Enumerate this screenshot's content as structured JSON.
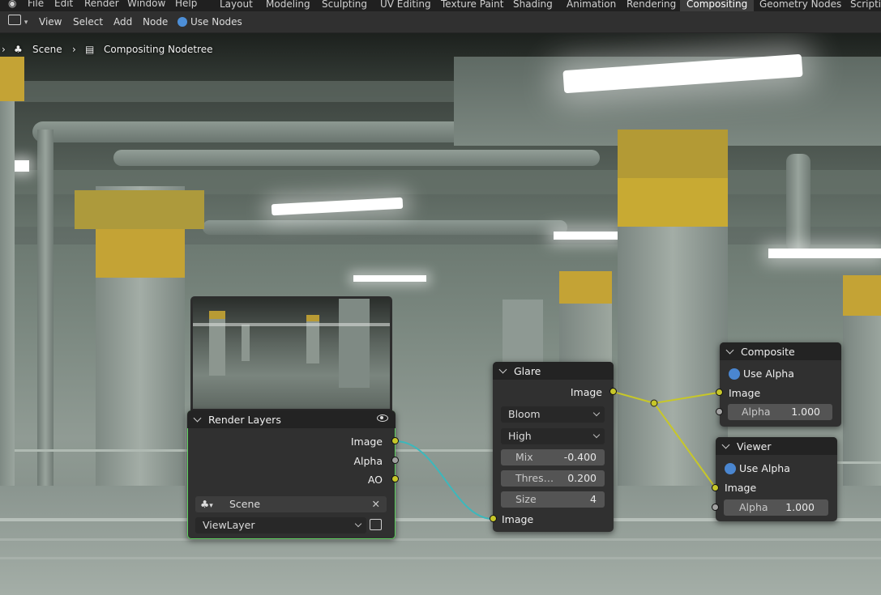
{
  "topbar": {
    "menus": [
      "File",
      "Edit",
      "Render",
      "Window",
      "Help"
    ],
    "workspaces": [
      "Layout",
      "Modeling",
      "Sculpting",
      "UV Editing",
      "Texture Paint",
      "Shading",
      "Animation",
      "Rendering",
      "Compositing",
      "Geometry Nodes",
      "Scripting"
    ],
    "active_workspace": "Compositing"
  },
  "header": {
    "editor_icon": "node-editor-icon",
    "menus": [
      "View",
      "Select",
      "Add",
      "Node"
    ],
    "use_nodes_label": "Use Nodes",
    "use_nodes_checked": true
  },
  "breadcrumb": {
    "scene": "Scene",
    "nodetree": "Compositing Nodetree"
  },
  "nodes": {
    "render_layers": {
      "title": "Render Layers",
      "outputs": [
        "Image",
        "Alpha",
        "AO"
      ],
      "scene_field": "Scene",
      "view_layer": "ViewLayer",
      "icons": [
        "eye-icon",
        "scene-icon",
        "clear-icon",
        "render-layer-icon"
      ]
    },
    "glare": {
      "title": "Glare",
      "output": "Image",
      "type": "Bloom",
      "quality": "High",
      "mix_label": "Mix",
      "mix_value": "-0.400",
      "threshold_label": "Thres…",
      "threshold_value": "0.200",
      "size_label": "Size",
      "size_value": "4",
      "input": "Image"
    },
    "composite": {
      "title": "Composite",
      "use_alpha": "Use Alpha",
      "input": "Image",
      "alpha_label": "Alpha",
      "alpha_value": "1.000"
    },
    "viewer": {
      "title": "Viewer",
      "use_alpha": "Use Alpha",
      "input": "Image",
      "alpha_label": "Alpha",
      "alpha_value": "1.000"
    }
  },
  "colors": {
    "image_socket": "#c7c729",
    "value_socket": "#a1a1a1",
    "active_node_outline": "#5fd15f",
    "checkbox_blue": "#4a86d0",
    "highlight_link": "#3cb8bc"
  }
}
